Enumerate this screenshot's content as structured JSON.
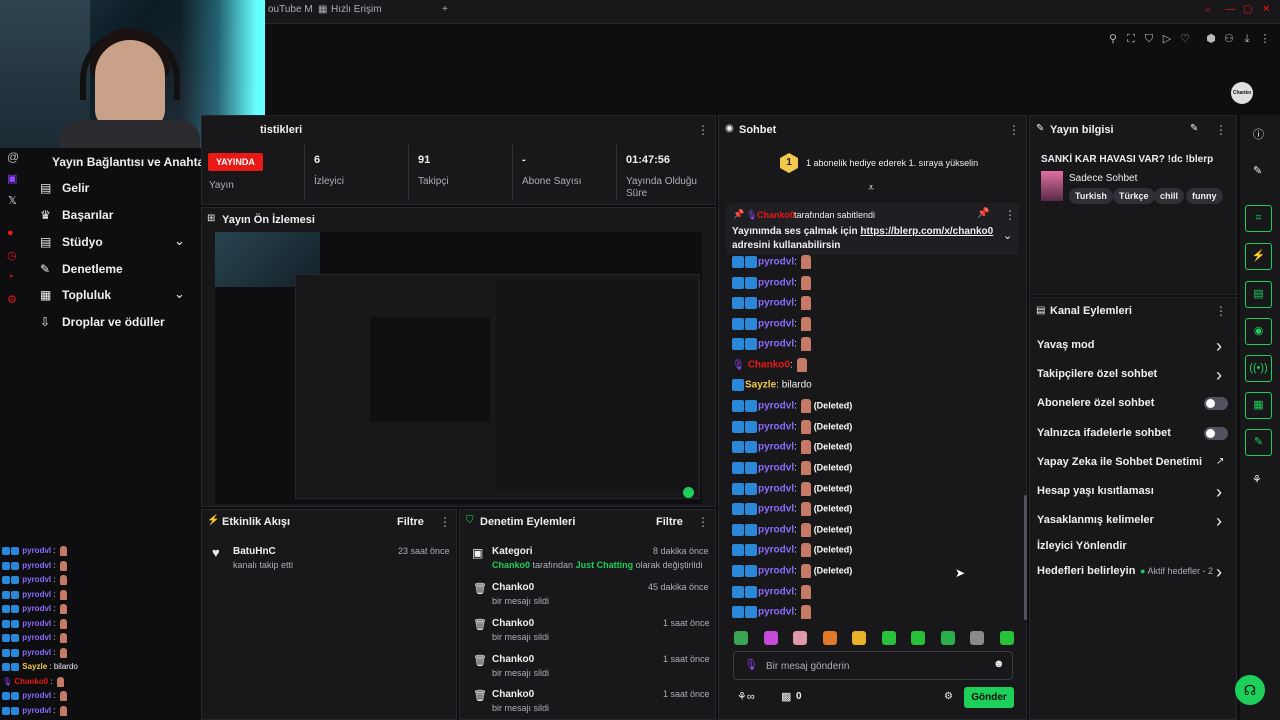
{
  "browser": {
    "tabs": [
      {
        "label": "ouTube M"
      },
      {
        "label": "Hızlı Erişim"
      }
    ],
    "new_tab": "+"
  },
  "nav": {
    "title": "Yayın Bağlantısı ve Anahtarı",
    "items": [
      {
        "label": "Gelir",
        "icon": "chart-icon"
      },
      {
        "label": "Başarılar",
        "icon": "trophy-icon"
      },
      {
        "label": "Stüdyo",
        "icon": "studio-icon"
      },
      {
        "label": "Denetleme",
        "icon": "wrench-icon"
      },
      {
        "label": "Topluluk",
        "icon": "community-icon"
      },
      {
        "label": "Droplar ve ödüller",
        "icon": "drops-icon"
      }
    ]
  },
  "stats": {
    "header": "tistikleri",
    "live": "YAYINDA",
    "items": [
      {
        "label": "Yayın",
        "value": ""
      },
      {
        "label": "İzleyici",
        "value": "6"
      },
      {
        "label": "Takipçi",
        "value": "91"
      },
      {
        "label": "Abone Sayısı",
        "value": "-"
      },
      {
        "label": "Yayında Olduğu Süre",
        "value": "01:47:56"
      }
    ]
  },
  "preview": {
    "header": "Yayın Ön İzlemesi"
  },
  "activity": {
    "header": "Etkinlik Akışı",
    "filter": "Filtre",
    "events": [
      {
        "user": "BatuHnC",
        "text": "kanalı takip etti",
        "time": "23 saat önce"
      }
    ]
  },
  "modactions": {
    "header": "Denetim Eylemleri",
    "filter": "Filtre",
    "items": [
      {
        "title": "Kategori",
        "time": "8 dakika önce",
        "sub_user": "Chanko0",
        "sub_mid": " tarafından ",
        "sub_cat": "Just Chatting",
        "sub_end": " olarak değiştirildi"
      },
      {
        "title": "Chanko0",
        "time": "45 dakika önce",
        "sub": "bir mesajı sildi"
      },
      {
        "title": "Chanko0",
        "time": "1 saat önce",
        "sub": "bir mesajı sildi"
      },
      {
        "title": "Chanko0",
        "time": "1 saat önce",
        "sub": "bir mesajı sildi"
      },
      {
        "title": "Chanko0",
        "time": "1 saat önce",
        "sub": "bir mesajı sildi"
      }
    ]
  },
  "chat": {
    "header": "Sohbet",
    "banner_num": "1",
    "banner": "1 abonelik hediye ederek 1. sıraya yükselin",
    "pinned_by_user": "Chanko0",
    "pinned_by": "tarafından sabitlendi",
    "pinned_text": "Yayınımda ses çalmak için ",
    "pinned_link": "https://blerp.com/x/chanko0",
    "pinned_end": "adresini kullanabilirsin",
    "messages": [
      {
        "user": "pyrodvl",
        "text": ""
      },
      {
        "user": "pyrodvl",
        "text": ""
      },
      {
        "user": "pyrodvl",
        "text": ""
      },
      {
        "user": "pyrodvl",
        "text": ""
      },
      {
        "user": "pyrodvl",
        "text": ""
      },
      {
        "user": "Chanko0",
        "text": ""
      },
      {
        "user": "Sayzle",
        "text": "bilardo"
      },
      {
        "user": "pyrodvl",
        "text": "(Deleted)"
      },
      {
        "user": "pyrodvl",
        "text": "(Deleted)"
      },
      {
        "user": "pyrodvl",
        "text": "(Deleted)"
      },
      {
        "user": "pyrodvl",
        "text": "(Deleted)"
      },
      {
        "user": "pyrodvl",
        "text": "(Deleted)"
      },
      {
        "user": "pyrodvl",
        "text": "(Deleted)"
      },
      {
        "user": "pyrodvl",
        "text": "(Deleted)"
      },
      {
        "user": "pyrodvl",
        "text": "(Deleted)"
      },
      {
        "user": "pyrodvl",
        "text": "(Deleted)"
      },
      {
        "user": "pyrodvl",
        "text": ""
      },
      {
        "user": "pyrodvl",
        "text": ""
      }
    ],
    "input_placeholder": "Bir mesaj gönderin",
    "points": "0",
    "send": "Gönder",
    "emote_colors": [
      "#3aa655",
      "#c44bd8",
      "#d9a",
      "#e07a2a",
      "#e8b32a",
      "#27c23a",
      "#27c23a",
      "#2ab04a",
      "#8a8a8a",
      "#27c23a"
    ]
  },
  "streaminfo": {
    "header": "Yayın bilgisi",
    "title": "SANKİ KAR HAVASI VAR? !dc !blerp",
    "category": "Sadece Sohbet",
    "tags": [
      "Turkish",
      "Türkçe",
      "chill",
      "funny"
    ]
  },
  "channel_actions": {
    "header": "Kanal Eylemleri",
    "items": [
      {
        "label": "Yavaş mod",
        "ctrl": "chevron"
      },
      {
        "label": "Takipçilere özel sohbet",
        "ctrl": "chevron"
      },
      {
        "label": "Abonelere özel sohbet",
        "ctrl": "toggle"
      },
      {
        "label": "Yalnızca ifadelerle sohbet",
        "ctrl": "toggle"
      },
      {
        "label": "Yapay Zeka ile Sohbet Denetimi",
        "ctrl": "external"
      },
      {
        "label": "Hesap yaşı kısıtlaması",
        "ctrl": "chevron"
      },
      {
        "label": "Yasaklanmış kelimeler",
        "ctrl": "chevron"
      },
      {
        "label": "İzleyici Yönlendir",
        "ctrl": "none"
      },
      {
        "label": "Hedefleri belirleyin",
        "ctrl": "chevron"
      }
    ],
    "goals_status": "Aktif hedefler - 2"
  },
  "overlay_chat": [
    {
      "user": "pyrodvl",
      "text": ":"
    },
    {
      "user": "pyrodvl",
      "text": ":"
    },
    {
      "user": "pyrodvl",
      "text": ":"
    },
    {
      "user": "pyrodvl",
      "text": ":"
    },
    {
      "user": "pyrodvl",
      "text": ":"
    },
    {
      "user": "pyrodvl",
      "text": ":"
    },
    {
      "user": "pyrodvl",
      "text": ":"
    },
    {
      "user": "pyrodvl",
      "text": ":"
    },
    {
      "user": "Sayzle",
      "text": ": bilardo"
    },
    {
      "user": "Chanko0",
      "text": ":"
    },
    {
      "user": "pyrodvl",
      "text": ":"
    },
    {
      "user": "pyrodvl",
      "text": ":"
    }
  ],
  "avatar_text": "Chanko",
  "colors": {
    "accent": "#1dd05a",
    "live": "#e91916",
    "username": "#8a6cff",
    "bg": "#0e0e10",
    "panel": "#18181b"
  }
}
